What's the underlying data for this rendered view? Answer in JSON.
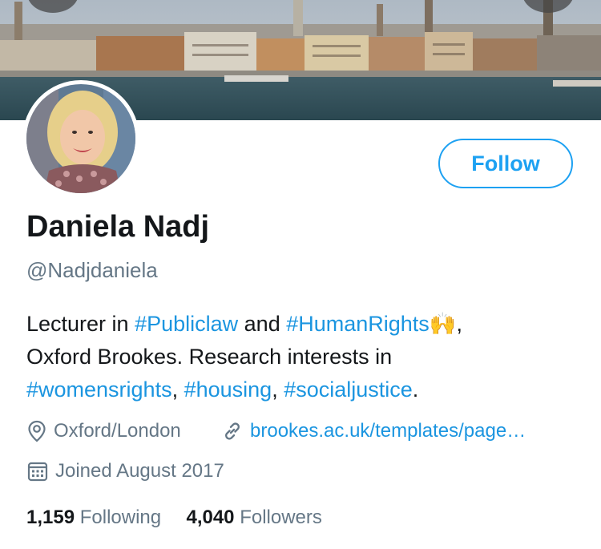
{
  "profile": {
    "name": "Daniela Nadj",
    "handle": "@Nadjdaniela",
    "follow_label": "Follow",
    "bio": {
      "p1": "Lecturer in ",
      "tag1": "#Publiclaw",
      "p2": " and ",
      "tag2": "#HumanRights",
      "emoji": "🙌",
      "p3": ",",
      "p4": "Oxford Brookes. Research interests in",
      "tag3": "#womensrights",
      "p5": ", ",
      "tag4": "#housing",
      "p6": ", ",
      "tag5": "#socialjustice",
      "p7": "."
    },
    "location": "Oxford/London",
    "website": "brookes.ac.uk/templates/page…",
    "joined": "Joined August 2017",
    "following_count": "1,159",
    "following_label": "Following",
    "followers_count": "4,040",
    "followers_label": "Followers"
  },
  "icons": {
    "location": "location-pin-icon",
    "website": "link-icon",
    "joined": "calendar-icon"
  },
  "colors": {
    "accent": "#1da1f2",
    "link": "#1b95e0",
    "secondary_text": "#657786",
    "primary_text": "#14171a"
  }
}
